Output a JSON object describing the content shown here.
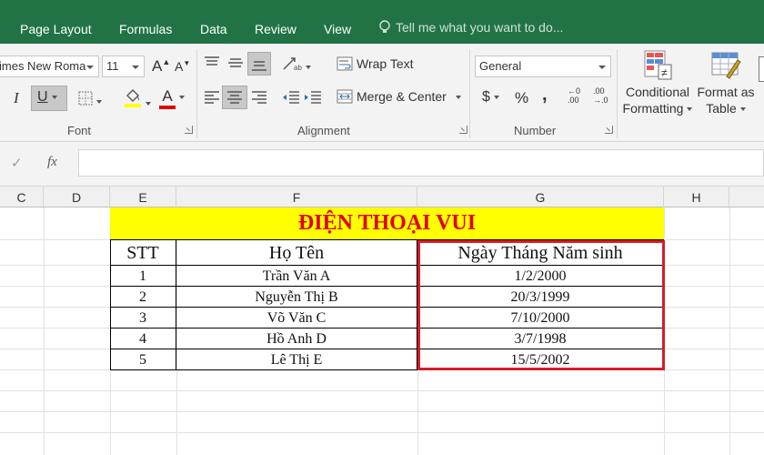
{
  "ribbon_tabs": [
    "Page Layout",
    "Formulas",
    "Data",
    "Review",
    "View"
  ],
  "tell_me": "Tell me what you want to do...",
  "font": {
    "name": "imes New Roma",
    "size": "11",
    "grow_label": "A",
    "shrink_label": "A",
    "italic_label": "I",
    "underline_label": "U",
    "font_color_letter": "A",
    "group_label": "Font"
  },
  "alignment": {
    "wrap_text": "Wrap Text",
    "merge_center": "Merge & Center",
    "group_label": "Alignment"
  },
  "number": {
    "format": "General",
    "currency": "$",
    "percent": "%",
    "comma": ",",
    "inc_decimal_top": "←0",
    "inc_decimal_bottom": ".00",
    "dec_decimal_top": ".00",
    "dec_decimal_bottom": "→.0",
    "group_label": "Number"
  },
  "styles": {
    "conditional_line1": "Conditional",
    "conditional_line2": "Formatting",
    "format_as_line1": "Format as",
    "format_as_line2": "Table"
  },
  "formula_bar": {
    "fx_label": "fx",
    "check_label": "✓",
    "value": ""
  },
  "columns": [
    "C",
    "D",
    "E",
    "F",
    "G",
    "H"
  ],
  "sheet": {
    "title": "ĐIỆN THOẠI VUI",
    "headers": [
      "STT",
      "Họ Tên",
      "Ngày Tháng Năm sinh"
    ],
    "rows": [
      [
        "1",
        "Trần Văn A",
        "1/2/2000"
      ],
      [
        "2",
        "Nguyễn Thị B",
        "20/3/1999"
      ],
      [
        "3",
        "Võ Văn C",
        "7/10/2000"
      ],
      [
        "4",
        "Hồ Anh D",
        "3/7/1998"
      ],
      [
        "5",
        "Lê Thị E",
        "15/5/2002"
      ]
    ]
  },
  "colors": {
    "tab_bar": "#217346",
    "title_fill": "#ffff00",
    "title_text": "#e00000",
    "highlight_border": "#d61d2a"
  }
}
